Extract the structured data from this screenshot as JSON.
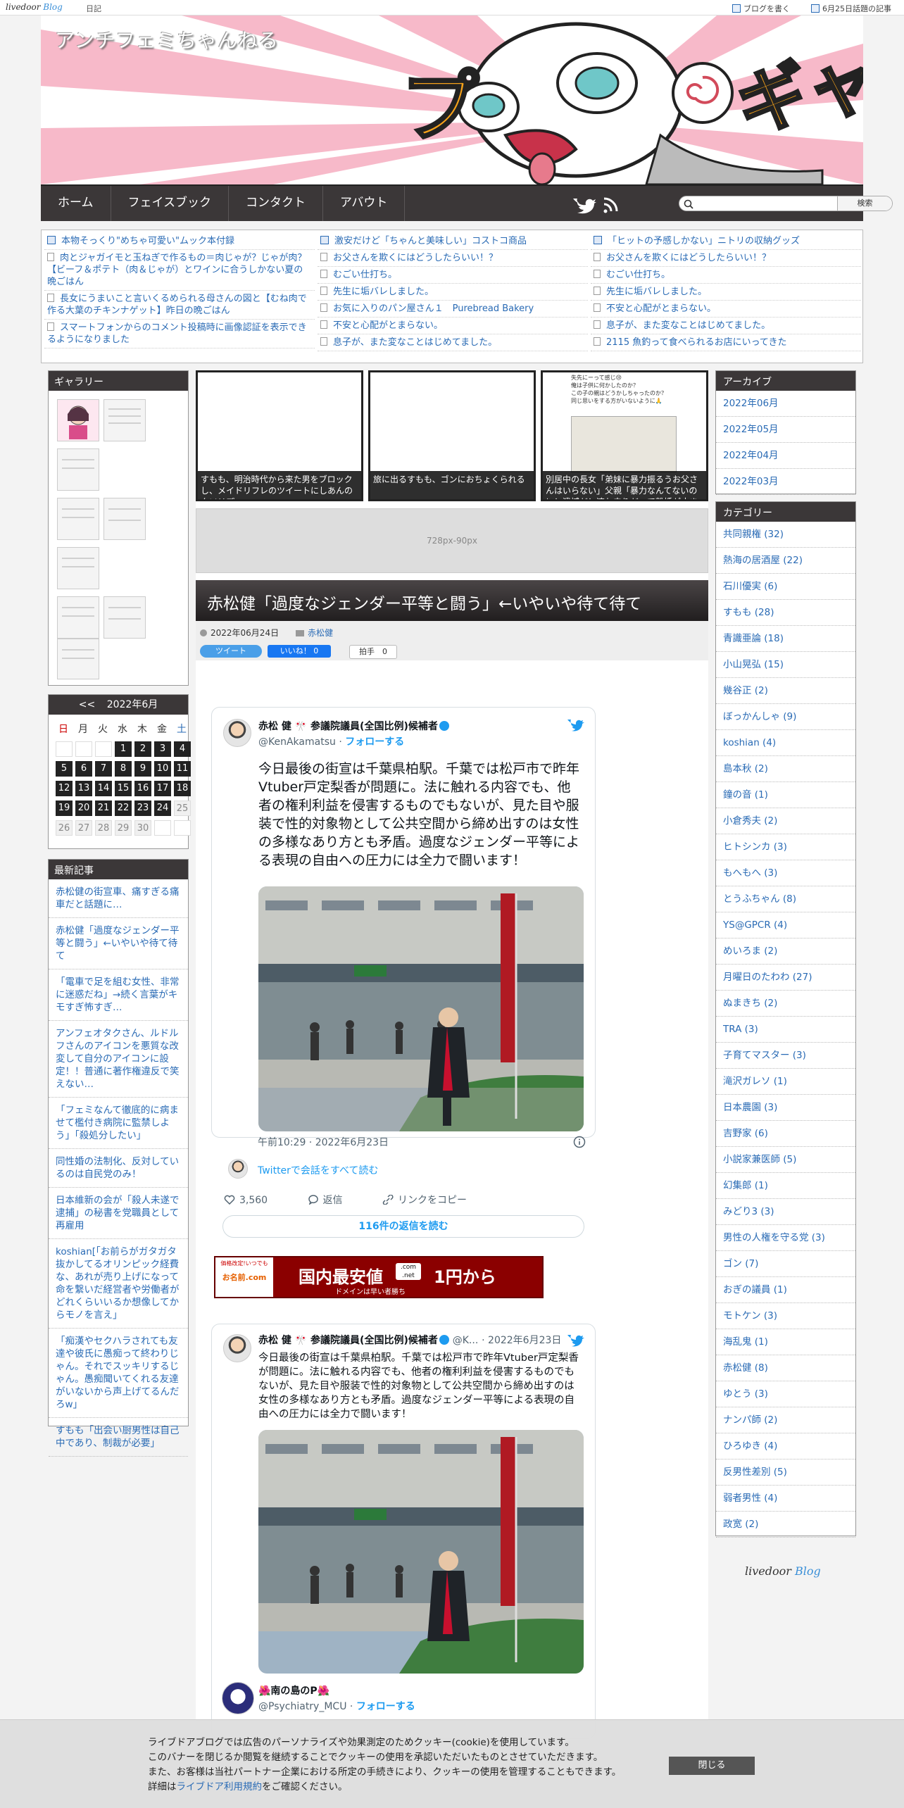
{
  "topbar": {
    "logo_main": "livedoor",
    "logo_sub": "Blog",
    "diary": "日記",
    "write": "ブログを書く",
    "today": "6月25日話題の記事"
  },
  "header": {
    "site_title": "アンチフェミちゃんねる",
    "art_text_left": "プ",
    "art_text_right": "ギャ"
  },
  "nav": {
    "items": [
      "ホーム",
      "フェイスブック",
      "コンタクト",
      "アバウト"
    ],
    "search_placeholder": "",
    "search_button": "検索"
  },
  "link_grid": {
    "col1": [
      "本物そっくり\"めちゃ可愛い\"ムック本付録",
      "肉とジャガイモと玉ねぎで作るもの＝肉じゃが？じゃが肉？【ビーフ＆ポテト（肉＆じゃが）とワインに合うしかない夏の晩ごはん",
      "長女にうまいこと言いくるめられる母さんの図と【むね肉で作る大葉のチキンナゲット】昨日の晩ごはん",
      "スマートフォンからのコメント投稿時に画像認証を表示できるようになりました"
    ],
    "col2": [
      "激安だけど「ちゃんと美味しい」コストコ商品",
      "お父さんを欺くにはどうしたらいい！？",
      "むごい仕打ち。",
      "先生に垢バレしました。",
      "お気に入りのパン屋さん１　Purebread Bakery",
      "不安と心配がとまらない。",
      "息子が、また変なことはじめてました。"
    ],
    "col3": [
      "「ヒットの予感しかない」ニトリの収納グッズ",
      "お父さんを欺くにはどうしたらいい！？",
      "むごい仕打ち。",
      "先生に垢バレしました。",
      "不安と心配がとまらない。",
      "息子が、また変なことはじめてました。",
      "2115 魚釣って食べられるお店にいってきた"
    ]
  },
  "gallery": {
    "title": "ギャラリー"
  },
  "calendar": {
    "prev": "<<",
    "title": "2022年6月",
    "dows": [
      "日",
      "月",
      "火",
      "水",
      "木",
      "金",
      "土"
    ],
    "weeks": [
      [
        "",
        "",
        "",
        "1",
        "2",
        "3",
        "4"
      ],
      [
        "5",
        "6",
        "7",
        "8",
        "9",
        "10",
        "11"
      ],
      [
        "12",
        "13",
        "14",
        "15",
        "16",
        "17",
        "18"
      ],
      [
        "19",
        "20",
        "21",
        "22",
        "23",
        "24",
        "25"
      ],
      [
        "26",
        "27",
        "28",
        "29",
        "30",
        "",
        ""
      ]
    ]
  },
  "recent": {
    "title": "最新記事",
    "items": [
      "赤松健の街宣車、痛すぎる痛車だと話題に…",
      "赤松健「過度なジェンダー平等と闘う」←いやいや待て待て",
      "「電車で足を組む女性、非常に迷惑だね」→続く言葉がキモすぎ怖すぎ…",
      "アンフェオタクさん、ルドルフさんのアイコンを悪質な改変して自分のアイコンに設定！！普通に著作権違反で笑えない…",
      "「フェミなんて徹底的に病ませて檻付き病院に監禁しよう」「殺処分したい」",
      "同性婚の法制化、反対しているのは自民党のみ！",
      "日本維新の会が「殺人未遂で逮捕」の秘書を党職員として再雇用",
      "koshian[「お前らがガタガタ抜かしてるオリンピック経費な、あれが売り上げになって命を繋いだ経営者や労働者がどれくらいいるか想像してからモノを言え」",
      "「痴漢やセクハラされても友達や彼氏に愚痴って終わりじゃん。それでスッキリするじゃん。愚痴聞いてくれる友達がいないから声上げてるんだろw」",
      "すもも「出会い厨男性は自己中であり、制裁が必要」"
    ]
  },
  "featured": [
    "すもも、明治時代から来た男をブロックし、メイドリフレのツイートにしあんのクソリプ",
    "旅に出るすもも、ゴンにおちょくられる",
    "別居中の長女「弟妹に暴力振るうお父さんはいらない」父親「暴力なんてないのに！遺憾だ！連れ去りだ」で離婚が止まらない"
  ],
  "featured_img_text": "失先にーって感じ😢\n俺は子供に何かしたのか？\nこの子の親はどうかしちゃったのか？\n同じ思いをする方がいないように🙏",
  "ad": {
    "label": "728px-90px"
  },
  "article": {
    "title": "赤松健「過度なジェンダー平等と闘う」←いやいや待て待て",
    "date": "2022年06月24日",
    "category": "赤松健",
    "tweet_btn": "ツイート",
    "like_btn": "いいね！ 0",
    "clap_btn": "拍手　0"
  },
  "tweet1": {
    "name": "赤松 健 🎌 参議院議員(全国比例)候補者",
    "handle": "@KenAkamatsu",
    "follow": "フォローする",
    "text": "今日最後の街宣は千葉県柏駅。千葉では松戸市で昨年Vtuber戸定梨香が問題に。法に触れる内容でも、他者の権利利益を侵害するものでもないが、見た目や服装で性的対象物として公共空間から締め出すのは女性の多様なあり方とも矛盾。過度なジェンダー平等による表現の自由への圧力には全力で闘います！",
    "time": "午前10:29 · 2022年6月23日",
    "conversation": "Twitterで会話をすべて読む",
    "likes": "3,560",
    "reply": "返信",
    "copy_link": "リンクをコピー",
    "read_replies": "116件の返信を読む"
  },
  "banner": {
    "tag": "価格改定!いつでも",
    "brand": "お名前.com",
    "main": "国内最安値",
    "tld": ".com .net",
    "price": "1円から",
    "sub": "ドメインは早い者勝ち"
  },
  "tweet2": {
    "name": "赤松 健 🎌 参議院議員(全国比例)候補者",
    "handle": "@K...",
    "date": "· 2022年6月23日",
    "text": "今日最後の街宣は千葉県柏駅。千葉では松戸市で昨年Vtuber戸定梨香が問題に。法に触れる内容でも、他者の権利利益を侵害するものでもないが、見た目や服装で性的対象物として公共空間から締め出すのは女性の多様なあり方とも矛盾。過度なジェンダー平等による表現の自由への圧力には全力で闘います！",
    "reply_name": "🌺南の島のP🌺",
    "reply_handle": "@Psychiatry_MCU",
    "reply_follow": "フォローする"
  },
  "archive": {
    "title": "アーカイブ",
    "items": [
      "2022年06月",
      "2022年05月",
      "2022年04月",
      "2022年03月"
    ]
  },
  "category": {
    "title": "カテゴリー",
    "items": [
      "共同親権 (32)",
      "熱海の居酒屋 (22)",
      "石川優実 (6)",
      "すもも (28)",
      "青識亜論 (18)",
      "小山晃弘 (15)",
      "幾谷正 (2)",
      "ぼっかんしゃ (9)",
      "koshian (4)",
      "島本秋 (2)",
      "鐘の音 (1)",
      "小倉秀夫 (2)",
      "ヒトシンカ (3)",
      "もへもへ (3)",
      "とうふちゃん (8)",
      "YS@GPCR (4)",
      "めいろま (2)",
      "月曜日のたわわ (27)",
      "ぬまきち (2)",
      "TRA (3)",
      "子育てマスター (3)",
      "滝沢ガレソ (1)",
      "日本農園 (3)",
      "吉野家 (6)",
      "小説家兼医師 (5)",
      "幻集郎 (1)",
      "みどり3 (3)",
      "男性の人権を守る党 (3)",
      "ゴン (7)",
      "おぎの議員 (1)",
      "モトケン (3)",
      "海乱鬼 (1)",
      "赤松健 (8)",
      "ゆとう (3)",
      "ナンパ師 (2)",
      "ひろゆき (4)",
      "反男性差別 (5)",
      "弱者男性 (4)",
      "政宽 (2)"
    ]
  },
  "footer": {
    "logo_main": "livedoor",
    "logo_sub": "Blog"
  },
  "cookie": {
    "line1": "ライブドアブログでは広告のパーソナライズや効果測定のためクッキー(cookie)を使用しています。",
    "line2": "このバナーを閉じるか閲覧を継続することでクッキーの使用を承認いただいたものとさせていただきます。",
    "line3": "また、お客様は当社パートナー企業における所定の手続きにより、クッキーの使用を管理することもできます。",
    "line4_pre": "詳細は",
    "line4_link": "ライブドア利用規約",
    "line4_post": "をご確認ください。",
    "close": "閉じる"
  },
  "colors": {
    "nav_bg": "#3b3738",
    "link": "#2a6bb5",
    "twitter": "#1d9bf0",
    "header_pink": "#f7b9c9"
  }
}
